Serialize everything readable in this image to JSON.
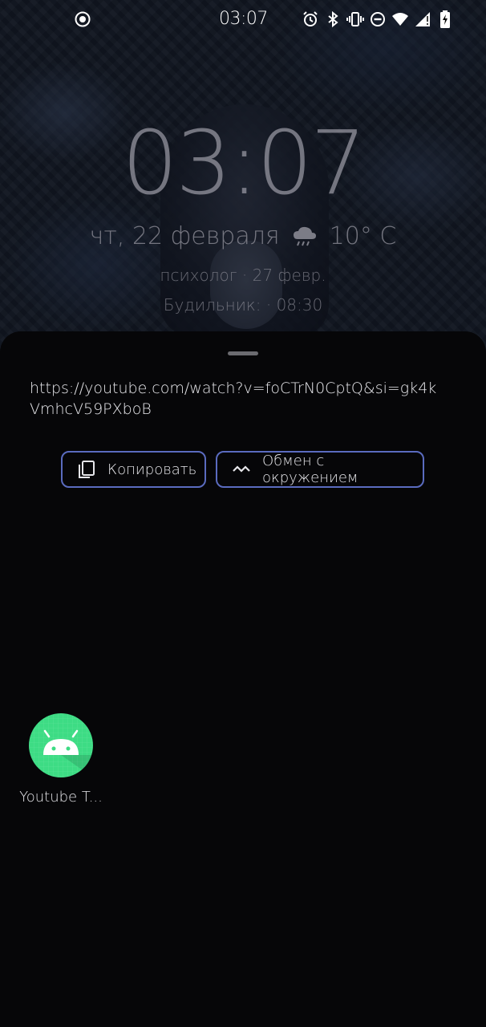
{
  "status_bar": {
    "time": "03:07",
    "left_icon": "screen-record-icon",
    "icons": [
      "alarm-icon",
      "bluetooth-icon",
      "vibrate-icon",
      "do-not-disturb-icon",
      "wifi-icon",
      "cell-signal-icon",
      "battery-charging-icon"
    ]
  },
  "lockscreen": {
    "clock": "03:07",
    "date": "чт, 22 февраля",
    "weather_icon": "rain-cloud-icon",
    "temperature": "10° C",
    "event": "психолог · 27 февр.",
    "alarm": "Будильник: · 08:30"
  },
  "share_sheet": {
    "url": "https://youtube.com/watch?v=foCTrN0CptQ&si=gk4kVmhcV59PXboB",
    "actions": [
      {
        "label": "Копировать",
        "icon": "copy-icon"
      },
      {
        "label": "Обмен с окружением",
        "icon": "nearby-share-icon"
      }
    ],
    "apps": [
      {
        "label": "Youtube T...",
        "icon": "android-app-icon"
      }
    ]
  },
  "colors": {
    "sheet_bg": "#060608",
    "button_border": "#5a6bbf",
    "android_green": "#3ddc84"
  }
}
